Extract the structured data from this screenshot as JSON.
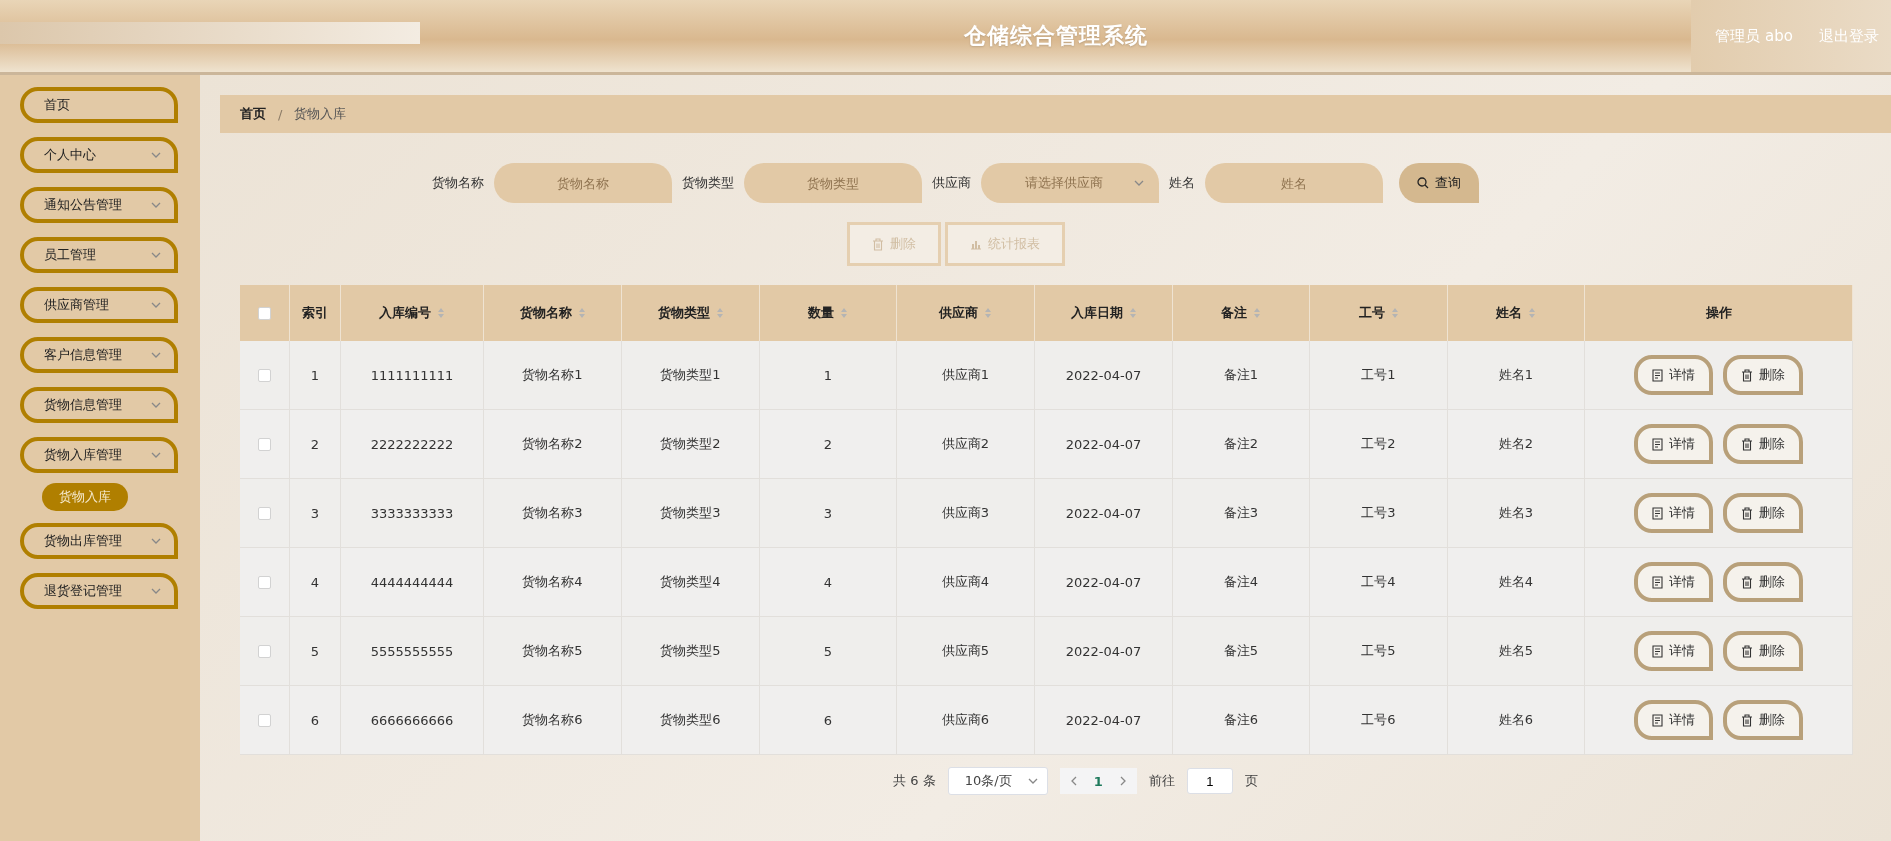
{
  "header": {
    "title": "仓储综合管理系统",
    "user": "管理员 abo",
    "logout": "退出登录"
  },
  "sidebar": {
    "items": [
      {
        "label": "首页",
        "kind": "link"
      },
      {
        "label": "个人中心",
        "kind": "menu"
      },
      {
        "label": "通知公告管理",
        "kind": "menu"
      },
      {
        "label": "员工管理",
        "kind": "menu"
      },
      {
        "label": "供应商管理",
        "kind": "menu"
      },
      {
        "label": "客户信息管理",
        "kind": "menu"
      },
      {
        "label": "货物信息管理",
        "kind": "menu"
      },
      {
        "label": "货物入库管理",
        "kind": "menu",
        "children": [
          {
            "label": "货物入库",
            "selected": true
          }
        ]
      },
      {
        "label": "货物出库管理",
        "kind": "menu"
      },
      {
        "label": "退货登记管理",
        "kind": "menu"
      }
    ]
  },
  "breadcrumb": {
    "items": [
      "首页",
      "货物入库"
    ],
    "separator": "/"
  },
  "search": {
    "fields": [
      {
        "label": "货物名称",
        "placeholder": "货物名称",
        "kind": "input"
      },
      {
        "label": "货物类型",
        "placeholder": "货物类型",
        "kind": "input"
      },
      {
        "label": "供应商",
        "placeholder": "请选择供应商",
        "kind": "select"
      },
      {
        "label": "姓名",
        "placeholder": "姓名",
        "kind": "input"
      }
    ],
    "button": "查询"
  },
  "actions": [
    {
      "label": "删除",
      "disabled": true
    },
    {
      "label": "统计报表",
      "disabled": true
    }
  ],
  "table": {
    "columns": [
      {
        "label": "索引",
        "sortable": false
      },
      {
        "label": "入库编号",
        "sortable": true
      },
      {
        "label": "货物名称",
        "sortable": true
      },
      {
        "label": "货物类型",
        "sortable": true
      },
      {
        "label": "数量",
        "sortable": true
      },
      {
        "label": "供应商",
        "sortable": true
      },
      {
        "label": "入库日期",
        "sortable": true
      },
      {
        "label": "备注",
        "sortable": true
      },
      {
        "label": "工号",
        "sortable": true
      },
      {
        "label": "姓名",
        "sortable": true
      },
      {
        "label": "操作",
        "sortable": false
      }
    ],
    "header_checked": false,
    "rows": [
      {
        "checked": false,
        "cells": [
          "1",
          "1111111111",
          "货物名称1",
          "货物类型1",
          "1",
          "供应商1",
          "2022-04-07",
          "备注1",
          "工号1",
          "姓名1"
        ],
        "actions": [
          "详情",
          "删除"
        ]
      },
      {
        "checked": false,
        "cells": [
          "2",
          "2222222222",
          "货物名称2",
          "货物类型2",
          "2",
          "供应商2",
          "2022-04-07",
          "备注2",
          "工号2",
          "姓名2"
        ],
        "actions": [
          "详情",
          "删除"
        ]
      },
      {
        "checked": false,
        "cells": [
          "3",
          "3333333333",
          "货物名称3",
          "货物类型3",
          "3",
          "供应商3",
          "2022-04-07",
          "备注3",
          "工号3",
          "姓名3"
        ],
        "actions": [
          "详情",
          "删除"
        ]
      },
      {
        "checked": false,
        "cells": [
          "4",
          "4444444444",
          "货物名称4",
          "货物类型4",
          "4",
          "供应商4",
          "2022-04-07",
          "备注4",
          "工号4",
          "姓名4"
        ],
        "actions": [
          "详情",
          "删除"
        ]
      },
      {
        "checked": false,
        "cells": [
          "5",
          "5555555555",
          "货物名称5",
          "货物类型5",
          "5",
          "供应商5",
          "2022-04-07",
          "备注5",
          "工号5",
          "姓名5"
        ],
        "actions": [
          "详情",
          "删除"
        ]
      },
      {
        "checked": false,
        "cells": [
          "6",
          "6666666666",
          "货物名称6",
          "货物类型6",
          "6",
          "供应商6",
          "2022-04-07",
          "备注6",
          "工号6",
          "姓名6"
        ],
        "actions": [
          "详情",
          "删除"
        ]
      }
    ]
  },
  "pagination": {
    "total": "共 6 条",
    "page_size": "10条/页",
    "pages": [
      {
        "label": "1",
        "selected": true
      }
    ],
    "goto_label": "前往",
    "goto_value": "1",
    "goto_suffix": "页"
  }
}
